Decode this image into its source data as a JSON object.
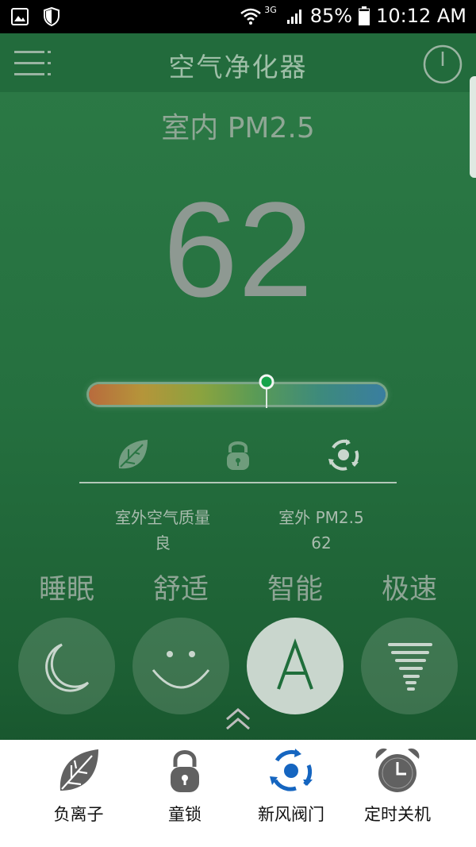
{
  "status_bar": {
    "network": "3G",
    "battery": "85%",
    "time": "10:12 AM"
  },
  "header": {
    "title": "空气净化器"
  },
  "indoor": {
    "label": "室内 PM2.5",
    "value": "62",
    "quality_level": 0.6
  },
  "feature_icons": [
    "leaf-icon",
    "lock-icon",
    "vent-icon"
  ],
  "outdoor": {
    "quality_label": "室外空气质量",
    "quality_value": "良",
    "pm_label": "室外 PM2.5",
    "pm_value": "62"
  },
  "modes": [
    {
      "label": "睡眠",
      "icon": "moon-icon"
    },
    {
      "label": "舒适",
      "icon": "smile-icon"
    },
    {
      "label": "智能",
      "icon": "auto-a-icon"
    },
    {
      "label": "极速",
      "icon": "tornado-icon"
    }
  ],
  "bottom_panel": {
    "items": [
      {
        "label": "负离子",
        "icon": "leaf-icon"
      },
      {
        "label": "童锁",
        "icon": "lock-icon"
      },
      {
        "label": "新风阀门",
        "icon": "vent-icon"
      },
      {
        "label": "定时关机",
        "icon": "alarm-clock-icon"
      }
    ]
  },
  "colors": {
    "background_green": "#25703f",
    "accent_blue": "#1565c0",
    "marker_green": "#16a34a"
  }
}
